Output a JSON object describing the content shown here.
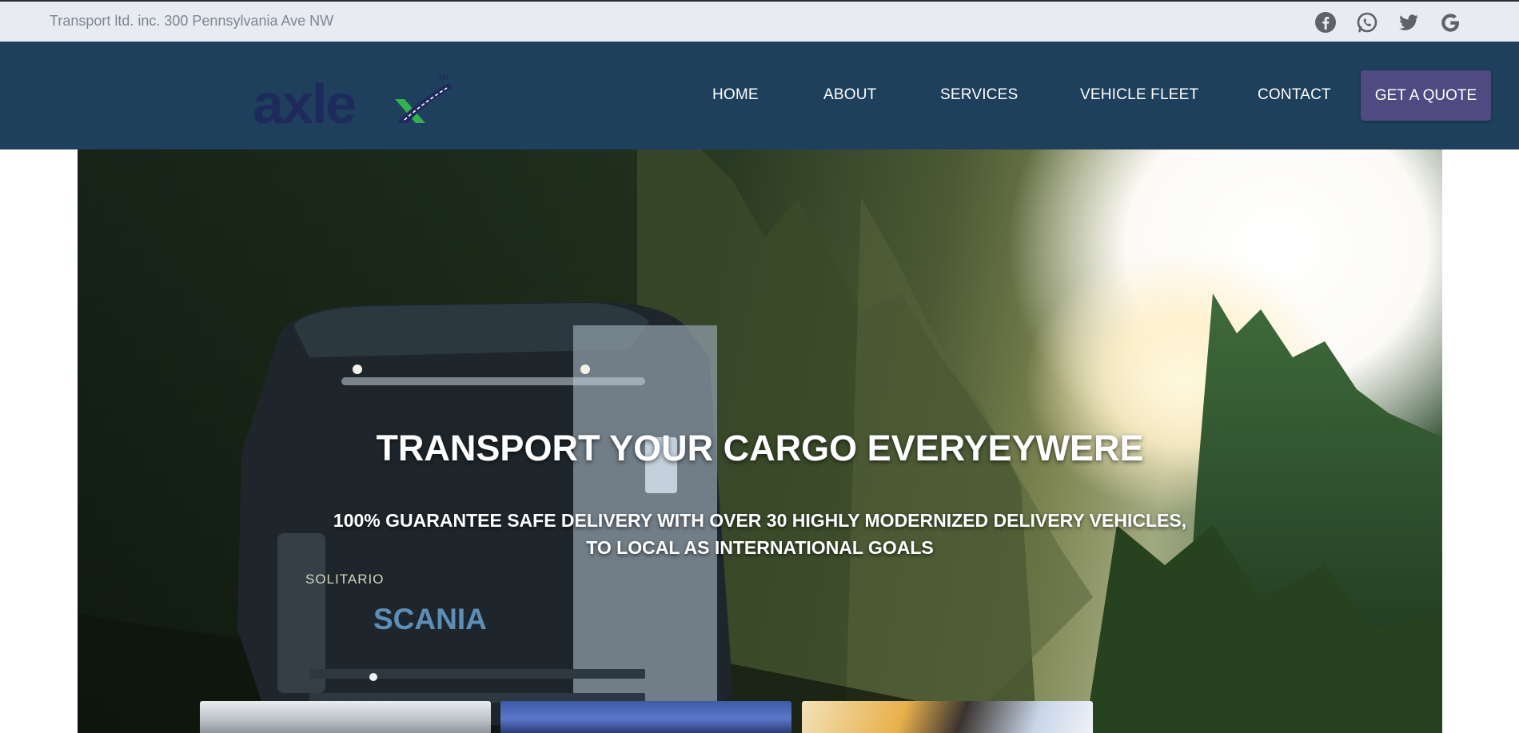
{
  "topbar": {
    "address": "Transport ltd. inc. 300 Pennsylvania Ave NW",
    "social": [
      "facebook-icon",
      "whatsapp-icon",
      "twitter-icon",
      "google-icon"
    ]
  },
  "brand": {
    "name": "axlex",
    "trademark": "TM",
    "colors": {
      "text": "#1f2a5c",
      "accent": "#2fb34a"
    }
  },
  "nav": {
    "items": [
      "HOME",
      "ABOUT",
      "SERVICES",
      "VEHICLE FLEET",
      "CONTACT"
    ],
    "cta": "GET A QUOTE"
  },
  "hero": {
    "title": "TRANSPORT YOUR CARGO EVERYEYWERE",
    "subtitle_line1": "100% GUARANTEE SAFE DELIVERY WITH OVER 30 HIGHLY MODERNIZED DELIVERY VEHICLES,",
    "subtitle_line2": "TO LOCAL AS INTERNATIONAL GOALS",
    "truck_brand": "SCANIA",
    "truck_plate": "SOLITARIO"
  },
  "colors": {
    "topbar_bg": "#e8ecf0",
    "navbar_bg": "#1e405d",
    "cta_bg": "#4f4a82"
  }
}
